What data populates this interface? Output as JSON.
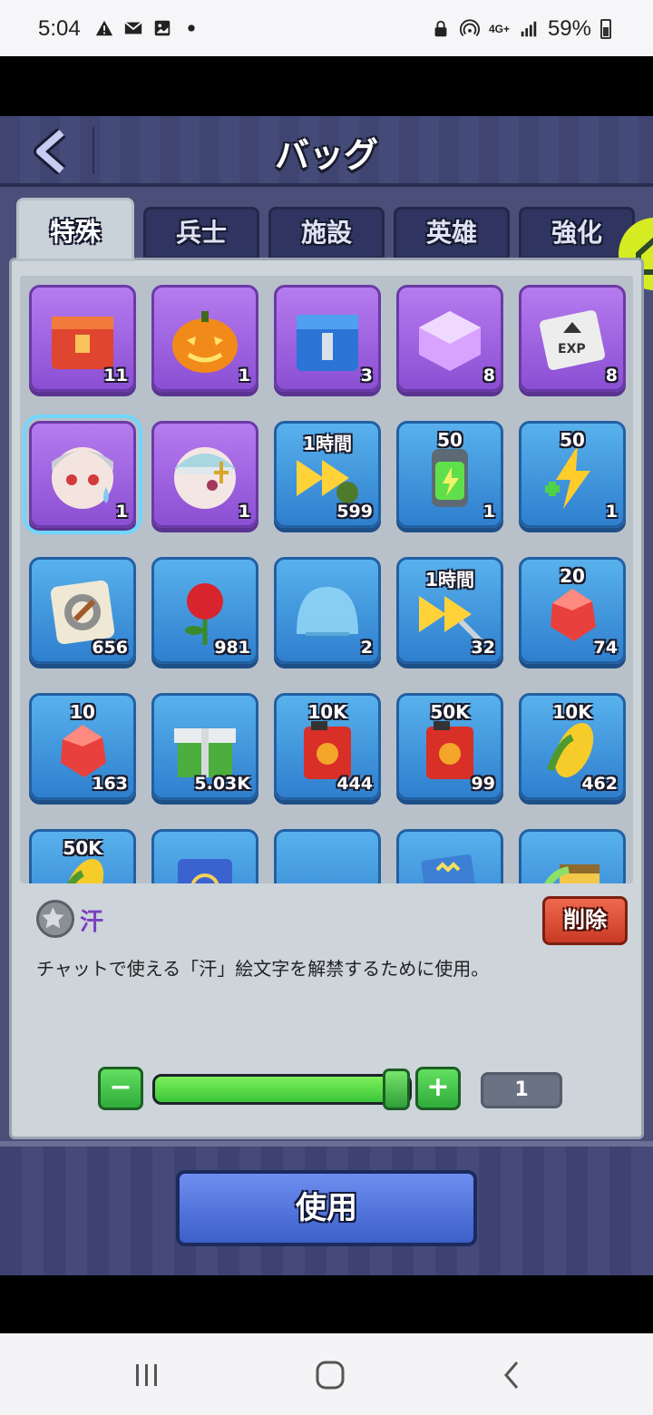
{
  "status_bar": {
    "time": "5:04",
    "left_icons": [
      "warning-icon",
      "mail-icon",
      "image-icon",
      "dot-icon"
    ],
    "battery_percent": "59%",
    "network_label": "4G+"
  },
  "header": {
    "title": "バッグ"
  },
  "tabs": [
    {
      "label": "特殊",
      "active": true
    },
    {
      "label": "兵士",
      "active": false
    },
    {
      "label": "施設",
      "active": false
    },
    {
      "label": "英雄",
      "active": false
    },
    {
      "label": "強化",
      "active": false
    }
  ],
  "items": [
    {
      "name": "red-supply-chest",
      "frame": "purple",
      "top_label": "",
      "count": "11"
    },
    {
      "name": "pumpkin",
      "frame": "purple",
      "top_label": "",
      "count": "1"
    },
    {
      "name": "blue-mech-chest",
      "frame": "purple",
      "top_label": "",
      "count": "3"
    },
    {
      "name": "purple-cube",
      "frame": "purple",
      "top_label": "",
      "count": "8"
    },
    {
      "name": "exp-card",
      "frame": "purple",
      "top_label": "",
      "count": "8"
    },
    {
      "name": "sweat-emoji-girl",
      "frame": "purple",
      "top_label": "",
      "count": "1",
      "selected": true
    },
    {
      "name": "bandaged-hero",
      "frame": "purple",
      "top_label": "",
      "count": "1"
    },
    {
      "name": "speedup-1h-soldier",
      "frame": "blue",
      "top_label": "1時間",
      "count": "599"
    },
    {
      "name": "energy-battery",
      "frame": "blue",
      "top_label": "50",
      "count": "1"
    },
    {
      "name": "energy-bolt",
      "frame": "blue",
      "top_label": "50",
      "count": "1"
    },
    {
      "name": "gear-badge",
      "frame": "blue",
      "top_label": "",
      "count": "656"
    },
    {
      "name": "red-rose",
      "frame": "blue",
      "top_label": "",
      "count": "981"
    },
    {
      "name": "shield-dome",
      "frame": "blue",
      "top_label": "",
      "count": "2"
    },
    {
      "name": "speedup-1h-tools",
      "frame": "blue",
      "top_label": "1時間",
      "count": "32"
    },
    {
      "name": "ruby-20",
      "frame": "blue",
      "top_label": "20",
      "count": "74"
    },
    {
      "name": "ruby-10",
      "frame": "blue",
      "top_label": "10",
      "count": "163"
    },
    {
      "name": "green-gift-box",
      "frame": "blue",
      "top_label": "",
      "count": "5.03K"
    },
    {
      "name": "fuel-can-10k",
      "frame": "blue",
      "top_label": "10K",
      "count": "444"
    },
    {
      "name": "fuel-can-50k",
      "frame": "blue",
      "top_label": "50K",
      "count": "99"
    },
    {
      "name": "corn-10k",
      "frame": "blue",
      "top_label": "10K",
      "count": "462"
    },
    {
      "name": "corn-50k",
      "frame": "blue",
      "top_label": "50K",
      "count": ""
    },
    {
      "name": "blue-card",
      "frame": "blue",
      "top_label": "",
      "count": ""
    },
    {
      "name": "green-pile",
      "frame": "blue",
      "top_label": "",
      "count": ""
    },
    {
      "name": "exp-book",
      "frame": "blue",
      "top_label": "",
      "count": ""
    },
    {
      "name": "building-upgrade",
      "frame": "blue",
      "top_label": "",
      "count": ""
    }
  ],
  "detail": {
    "name": "汗",
    "description": "チャットで使える「汗」絵文字を解禁するために使用。",
    "delete_label": "削除"
  },
  "quantity": {
    "minus": "−",
    "plus": "+",
    "value": "1",
    "fill_fraction": 1.0
  },
  "use_button": "使用",
  "colors": {
    "accent_green": "#3cc63a",
    "purple_frame": "#8b4fd3",
    "blue_frame": "#2f7fce",
    "delete_red": "#c93a25",
    "use_blue": "#3c5fc9"
  }
}
